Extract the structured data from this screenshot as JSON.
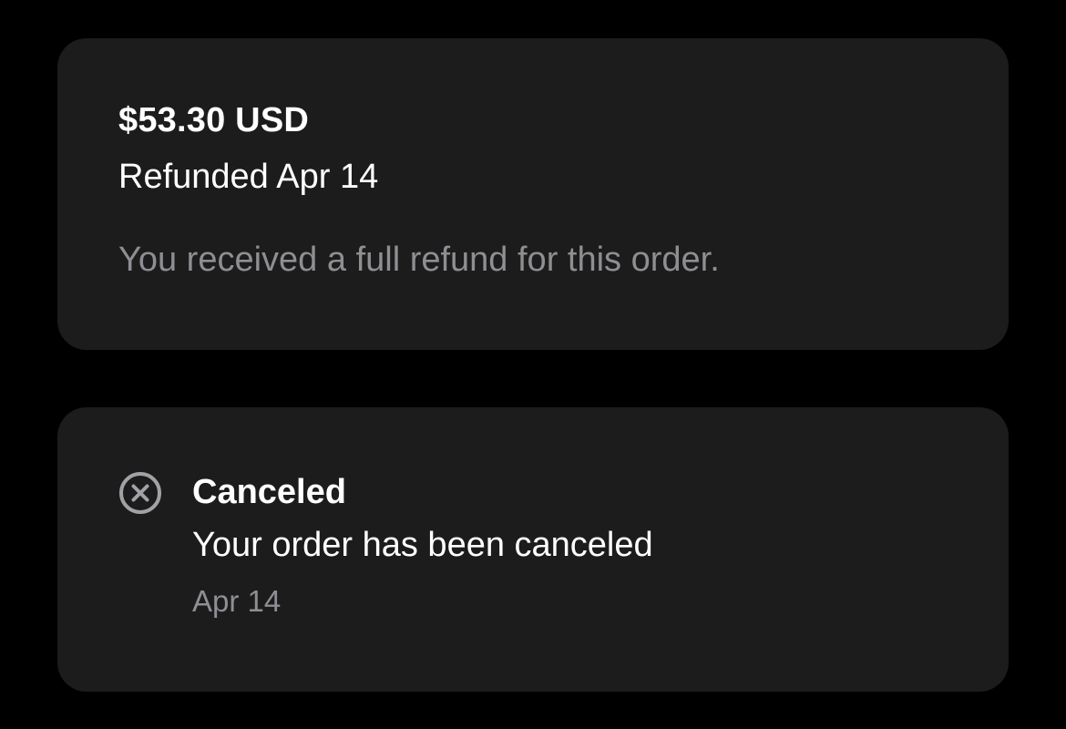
{
  "refund_card": {
    "amount": "$53.30 USD",
    "status_line": "Refunded Apr 14",
    "description": "You received a full refund for this order."
  },
  "status_card": {
    "icon": "x-circle-icon",
    "title": "Canceled",
    "message": "Your order has been canceled",
    "date": "Apr 14"
  },
  "colors": {
    "background": "#000000",
    "card": "#1c1c1c",
    "primary_text": "#ffffff",
    "secondary_text": "#8e8e93",
    "icon": "#a1a1a6"
  }
}
